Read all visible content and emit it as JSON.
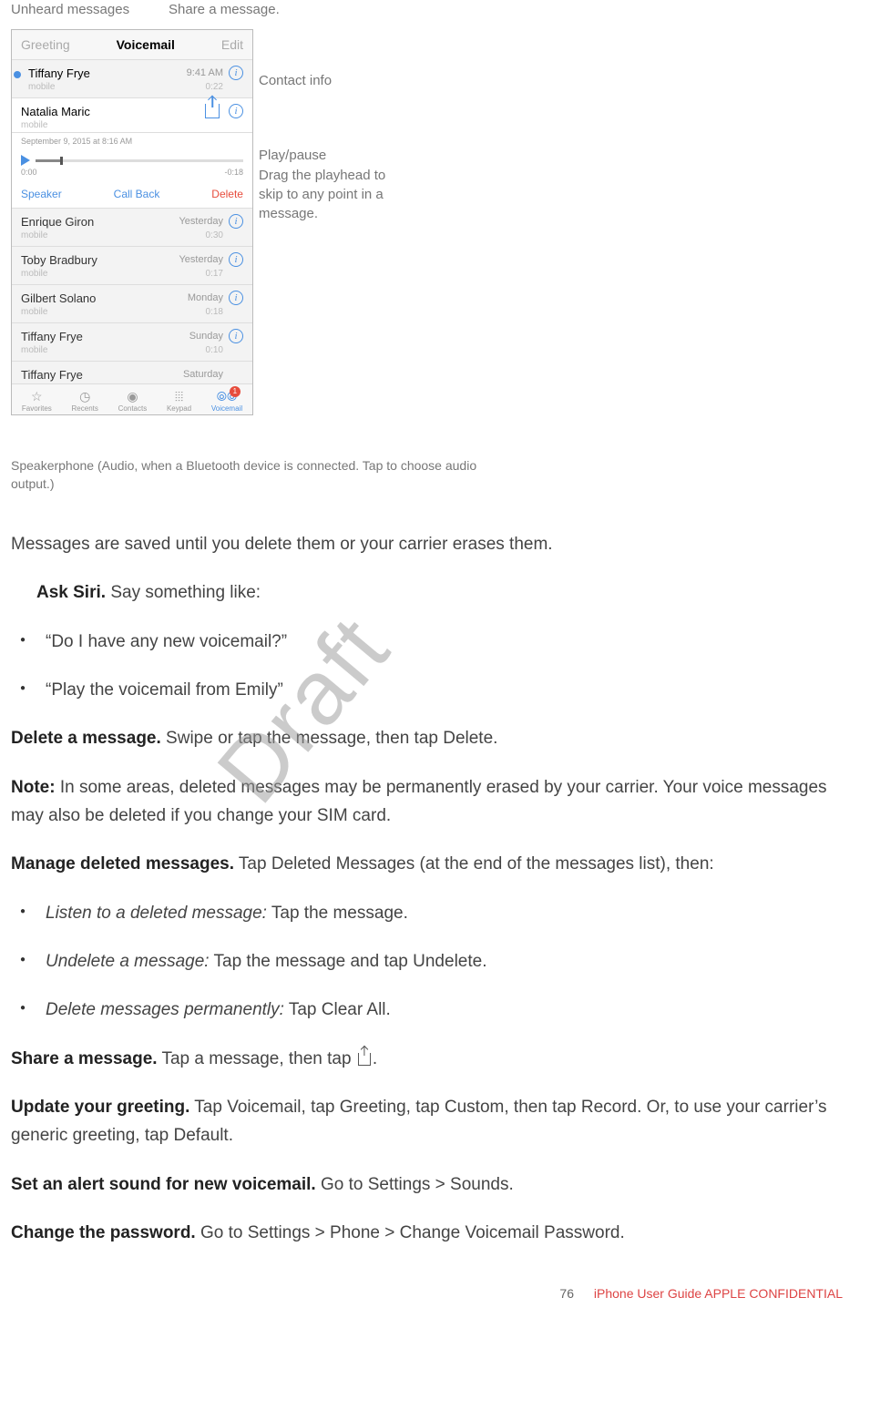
{
  "callouts": {
    "unheard": "Unheard messages",
    "share": "Share a message.",
    "contact": "Contact info",
    "playpause": "Play/pause",
    "drag": "Drag the playhead to skip to any point in a message.",
    "speaker_caption": "Speakerphone (Audio, when a Bluetooth device is connected. Tap to choose audio output.)"
  },
  "vm": {
    "header": {
      "left": "Greeting",
      "center": "Voicemail",
      "right": "Edit"
    },
    "rows": [
      {
        "name": "Tiffany Frye",
        "sub": "mobile",
        "time": "9:41 AM",
        "dur": "0:22"
      },
      {
        "name": "Natalia Maric",
        "sub": "mobile",
        "stamp": "September 9, 2015 at 8:16 AM"
      },
      {
        "name": "Enrique Giron",
        "sub": "mobile",
        "time": "Yesterday",
        "dur": "0:30"
      },
      {
        "name": "Toby Bradbury",
        "sub": "mobile",
        "time": "Yesterday",
        "dur": "0:17"
      },
      {
        "name": "Gilbert Solano",
        "sub": "mobile",
        "time": "Monday",
        "dur": "0:18"
      },
      {
        "name": "Tiffany Frye",
        "sub": "mobile",
        "time": "Sunday",
        "dur": "0:10"
      },
      {
        "name": "Tiffany Frye",
        "sub": "",
        "time": "Saturday",
        "dur": ""
      }
    ],
    "scrub": {
      "start": "0:00",
      "end": "-0:18"
    },
    "actions": {
      "speaker": "Speaker",
      "callback": "Call Back",
      "delete": "Delete"
    },
    "tabs": {
      "favorites": "Favorites",
      "recents": "Recents",
      "contacts": "Contacts",
      "keypad": "Keypad",
      "voicemail": "Voicemail",
      "badge": "1"
    }
  },
  "body": {
    "p1": "Messages are saved until you delete them or your carrier erases them.",
    "ask_siri_label": "Ask Siri.",
    "ask_siri_text": " Say something like:",
    "siri1": "“Do I have any new voicemail?”",
    "siri2": "“Play the voicemail from Emily”",
    "delete_label": "Delete a message.",
    "delete_text": " Swipe or tap the message, then tap Delete.",
    "note_label": "Note:",
    "note_text": " In some areas, deleted messages may be permanently erased by your carrier. Your voice messages may also be deleted if you change your SIM card.",
    "manage_label": "Manage deleted messages.",
    "manage_text": " Tap Deleted Messages (at the end of the messages list), then:",
    "li1_em": "Listen to a deleted message:",
    "li1_text": " Tap the message.",
    "li2_em": "Undelete a message:",
    "li2_text": " Tap the message and tap Undelete.",
    "li3_em": "Delete messages permanently:",
    "li3_text": " Tap Clear All.",
    "share_label": "Share a message.",
    "share_text_a": " Tap a message, then tap ",
    "share_text_b": ".",
    "greet_label": "Update your greeting.",
    "greet_text": " Tap Voicemail, tap Greeting, tap Custom, then tap Record. Or, to use your carrier’s generic greeting, tap Default.",
    "alert_label": "Set an alert sound for new voicemail.",
    "alert_text": " Go to Settings > Sounds.",
    "pw_label": "Change the password.",
    "pw_text": " Go to Settings > Phone > Change Voicemail Password."
  },
  "watermark": "Draft",
  "footer": {
    "page": "76",
    "conf": "iPhone User Guide  APPLE CONFIDENTIAL"
  }
}
